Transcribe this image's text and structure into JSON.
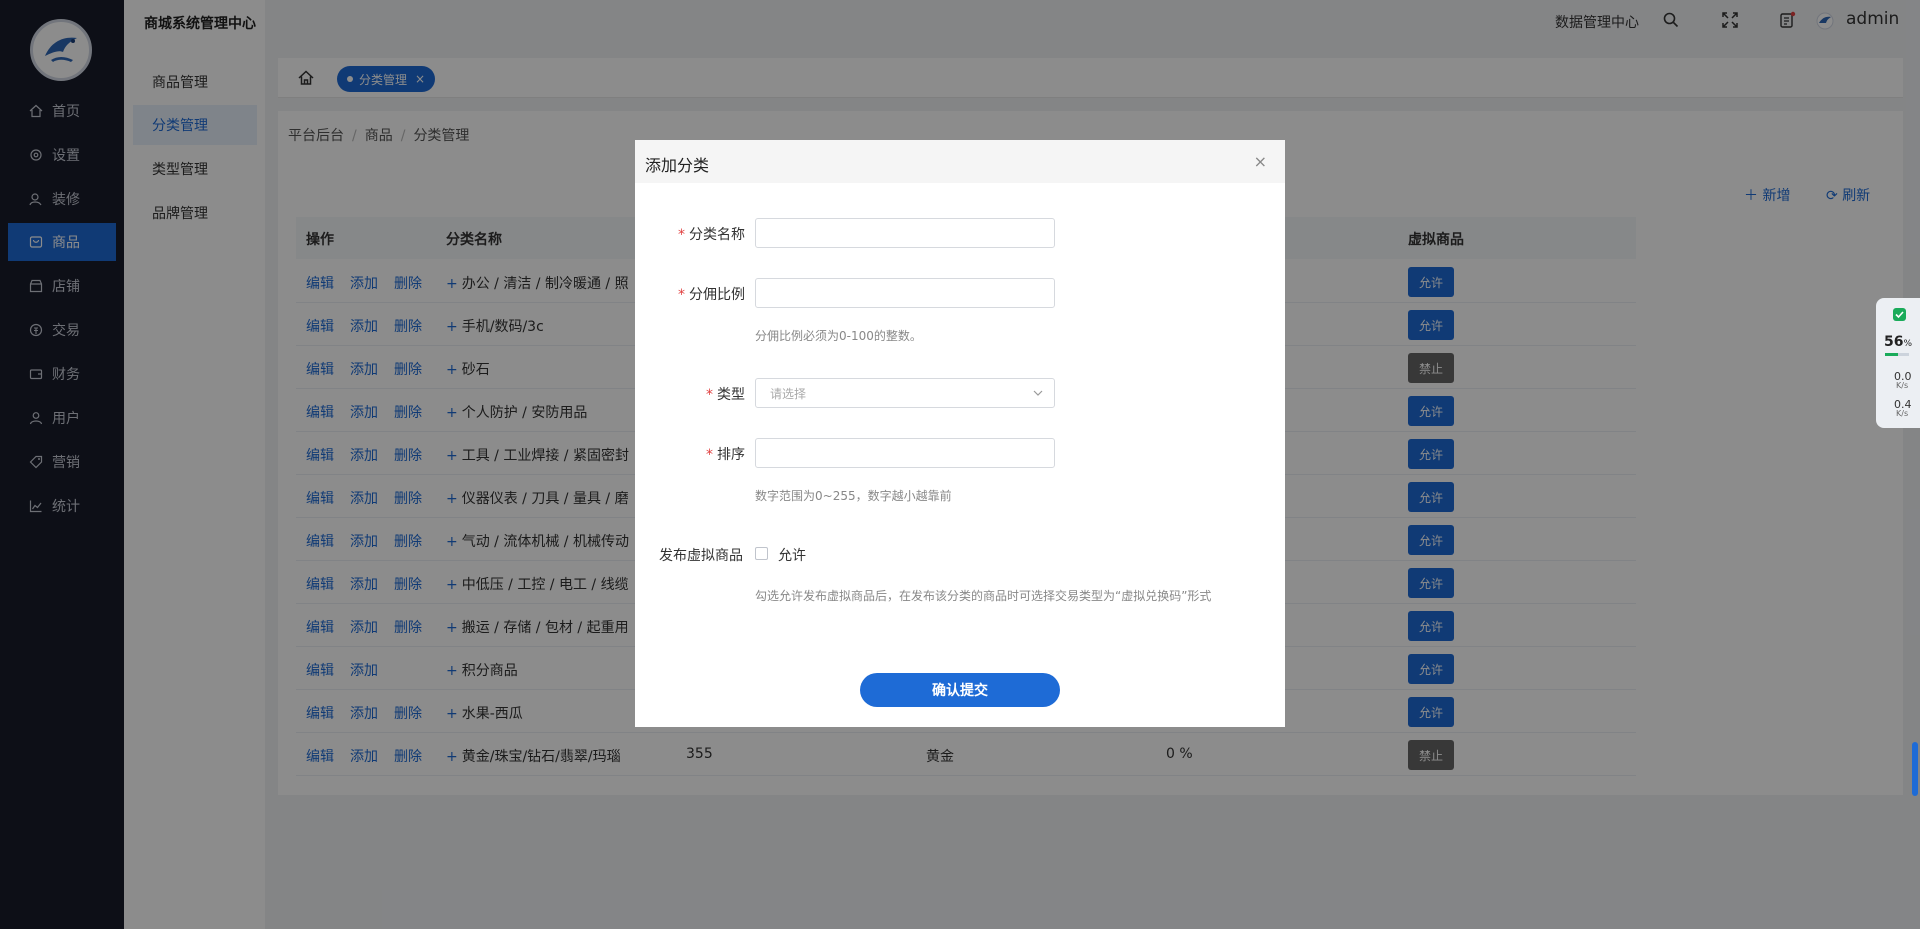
{
  "app": {
    "title": "商城系统管理中心"
  },
  "header": {
    "data_center": "数据管理中心",
    "user": "admin"
  },
  "sidebar": {
    "items": [
      {
        "label": "首页",
        "icon": "home-icon"
      },
      {
        "label": "设置",
        "icon": "gear-icon"
      },
      {
        "label": "装修",
        "icon": "paint-icon"
      },
      {
        "label": "商品",
        "icon": "goods-icon"
      },
      {
        "label": "店铺",
        "icon": "shop-icon"
      },
      {
        "label": "交易",
        "icon": "trade-icon"
      },
      {
        "label": "财务",
        "icon": "wallet-icon"
      },
      {
        "label": "用户",
        "icon": "user-icon"
      },
      {
        "label": "营销",
        "icon": "tag-icon"
      },
      {
        "label": "统计",
        "icon": "chart-icon"
      }
    ]
  },
  "subnav": {
    "items": [
      {
        "label": "商品管理"
      },
      {
        "label": "分类管理"
      },
      {
        "label": "类型管理"
      },
      {
        "label": "品牌管理"
      }
    ]
  },
  "tabs": {
    "active": "分类管理",
    "close": "×"
  },
  "breadcrumb": {
    "a": "平台后台",
    "b": "商品",
    "c": "分类管理",
    "sep": "/"
  },
  "toolbar": {
    "add": "新增",
    "refresh": "刷新"
  },
  "table": {
    "headers": {
      "op": "操作",
      "name": "分类名称",
      "virtual": "虚拟商品"
    },
    "op_edit": "编辑",
    "op_add": "添加",
    "op_delete": "删除",
    "expand": "+",
    "rows": [
      {
        "name": "办公 / 清洁 / 制冷暖通 / 照",
        "virtual": "允许",
        "status": "allow",
        "del": true
      },
      {
        "name": "手机/数码/3c",
        "virtual": "允许",
        "status": "allow",
        "del": true
      },
      {
        "name": "砂石",
        "virtual": "禁止",
        "status": "deny",
        "del": true
      },
      {
        "name": "个人防护 / 安防用品",
        "virtual": "允许",
        "status": "allow",
        "del": true
      },
      {
        "name": "工具 / 工业焊接 / 紧固密封",
        "virtual": "允许",
        "status": "allow",
        "del": true
      },
      {
        "name": "仪器仪表 / 刀具 / 量具 / 磨",
        "virtual": "允许",
        "status": "allow",
        "del": true
      },
      {
        "name": "气动 / 流体机械 / 机械传动",
        "virtual": "允许",
        "status": "allow",
        "del": true
      },
      {
        "name": "中低压 / 工控 / 电工 / 线缆",
        "virtual": "允许",
        "status": "allow",
        "del": true
      },
      {
        "name": "搬运 / 存储 / 包材 / 起重用",
        "virtual": "允许",
        "status": "allow",
        "del": true
      },
      {
        "name": "积分商品",
        "virtual": "允许",
        "status": "allow",
        "del": false
      },
      {
        "name": "水果-西瓜",
        "virtual": "允许",
        "status": "allow",
        "del": true
      },
      {
        "name": "黄金/珠宝/钻石/翡翠/玛瑙",
        "virtual": "禁止",
        "status": "deny",
        "del": true,
        "c3": "355",
        "c4": "黄金",
        "c5": "0 %"
      }
    ]
  },
  "widget": {
    "percent": "56",
    "pct_sign": "%",
    "up": "0.0",
    "down": "0.4",
    "unit": "K/s"
  },
  "modal": {
    "title": "添加分类",
    "close": "×",
    "fields": {
      "name_label": "分类名称",
      "commission_label": "分佣比例",
      "commission_hint": "分佣比例必须为0-100的整数。",
      "type_label": "类型",
      "type_placeholder": "请选择",
      "sort_label": "排序",
      "sort_hint": "数字范围为0~255，数字越小越靠前",
      "virtual_label": "发布虚拟商品",
      "virtual_option": "允许",
      "virtual_hint": "勾选允许发布虚拟商品后，在发布该分类的商品时可选择交易类型为“虚拟兑换码”形式",
      "required_mark": "*"
    },
    "submit": "确认提交"
  }
}
